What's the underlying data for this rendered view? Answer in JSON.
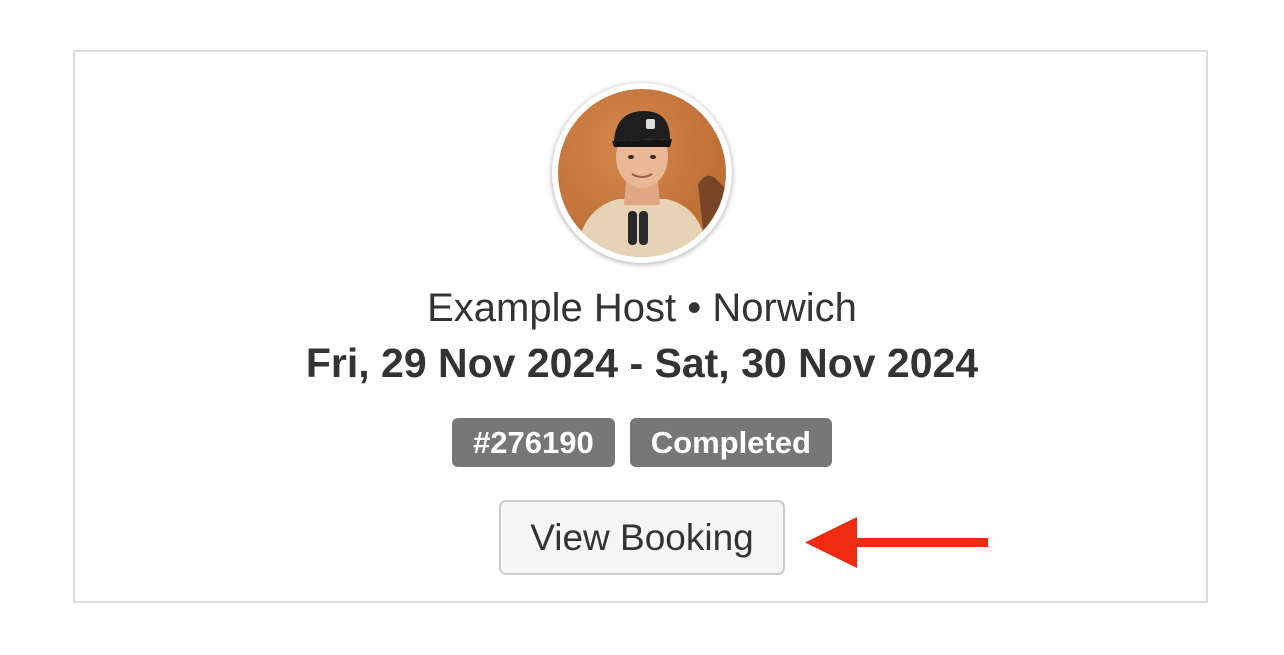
{
  "card": {
    "host_name": "Example Host",
    "separator": "•",
    "location": "Norwich",
    "dates": "Fri, 29 Nov 2024 - Sat, 30 Nov 2024",
    "booking_id": "#276190",
    "status": "Completed",
    "view_button_label": "View Booking"
  },
  "colors": {
    "badge_bg": "#777777",
    "arrow": "#ee2a11",
    "card_border": "#dddddd"
  },
  "icons": {
    "arrow": "left-arrow-icon"
  }
}
